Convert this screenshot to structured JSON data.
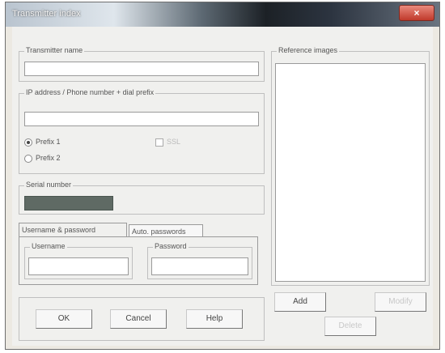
{
  "window": {
    "title": "Transmitter index",
    "close_glyph": "×"
  },
  "transmitter_name": {
    "label": "Transmitter name",
    "value": ""
  },
  "ip_group": {
    "label": "IP address / Phone number + dial prefix",
    "value": "",
    "prefix1_label": "Prefix 1",
    "prefix2_label": "Prefix 2",
    "selected": "Prefix 1",
    "checkbox_label": "SSL",
    "checkbox_checked": false
  },
  "serial": {
    "label": "Serial number"
  },
  "tabs": [
    {
      "label": "Username & password",
      "active": true
    },
    {
      "label": "Auto. passwords",
      "active": false
    }
  ],
  "credentials": {
    "username_label": "Username",
    "username_value": "",
    "password_label": "Password",
    "password_value": ""
  },
  "buttons": {
    "ok": "OK",
    "cancel": "Cancel",
    "help": "Help",
    "add": "Add",
    "modify": "Modify",
    "delete": "Delete"
  },
  "reference_images": {
    "label": "Reference images"
  }
}
